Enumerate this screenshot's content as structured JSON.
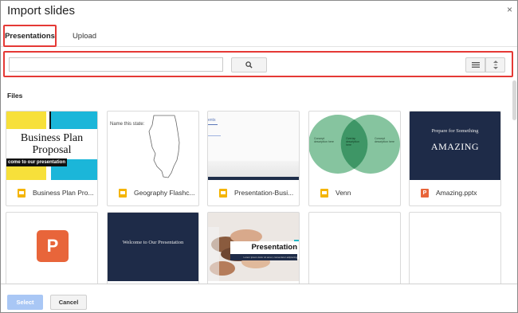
{
  "dialog": {
    "title": "Import slides",
    "close_glyph": "×"
  },
  "tabs": [
    {
      "label": "Presentations",
      "active": true
    },
    {
      "label": "Upload",
      "active": false
    }
  ],
  "search": {
    "value": "",
    "placeholder": ""
  },
  "files_label": "Files",
  "files": [
    {
      "name": "Business Plan Pro...",
      "type": "slides",
      "thumb": {
        "line1": "Business Plan",
        "line2": "Proposal",
        "banner": "come to our presentation"
      }
    },
    {
      "name": "Geography Flashc...",
      "type": "slides",
      "thumb": {
        "label": "Name this state:"
      }
    },
    {
      "name": "Presentation-Busi...",
      "type": "slides",
      "thumb": {
        "word": "ents"
      }
    },
    {
      "name": "Venn",
      "type": "slides",
      "thumb": {
        "left": "Concept description here",
        "center": "Overlap description here",
        "right": "Concept description here"
      }
    },
    {
      "name": "Amazing.pptx",
      "type": "ppt",
      "thumb": {
        "line1": "Prepare for Something",
        "line2": "AMAZING"
      }
    },
    {
      "name": "",
      "type": "ppt-icon",
      "thumb": {
        "letter": "P"
      }
    },
    {
      "name": "",
      "type": "blank",
      "thumb": {
        "line1": "Welcome to Our Presentation"
      }
    },
    {
      "name": "",
      "type": "blank",
      "thumb": {
        "title": "Presentation",
        "subtitle": "Lorem ipsum dolor sit amet, consectetur adipiscing"
      }
    },
    {
      "name": "",
      "type": "blank",
      "thumb": {}
    },
    {
      "name": "",
      "type": "blank",
      "thumb": {}
    }
  ],
  "footer": {
    "select_label": "Select",
    "cancel_label": "Cancel"
  },
  "colors": {
    "highlight": "#e53935",
    "slides_icon": "#f4b400",
    "ppt_icon": "#e8653a",
    "select_button": "#a9c7f5"
  }
}
